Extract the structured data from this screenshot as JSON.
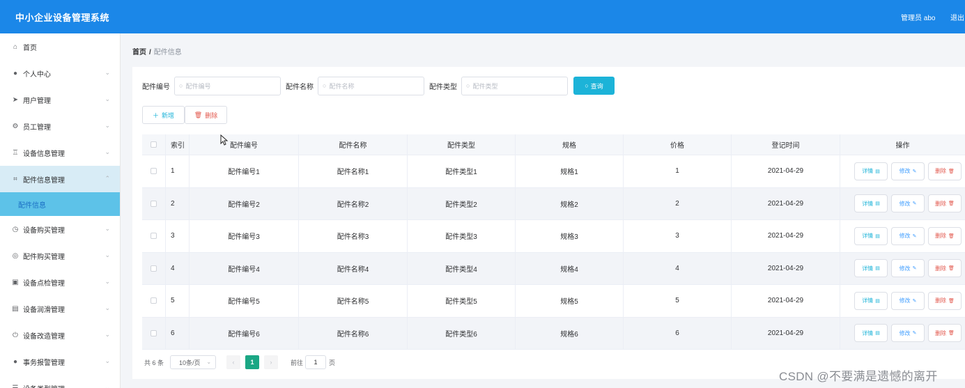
{
  "header": {
    "title": "中小企业设备管理系统",
    "admin": "管理员 abo",
    "logout": "退出"
  },
  "sidebar": {
    "items": [
      {
        "label": "首页",
        "icon": "home-icon",
        "glyph": "⌂",
        "chev": ""
      },
      {
        "label": "个人中心",
        "icon": "user-icon",
        "glyph": "●",
        "chev": "⌄"
      },
      {
        "label": "用户管理",
        "icon": "send-icon",
        "glyph": "➤",
        "chev": "⌄"
      },
      {
        "label": "员工管理",
        "icon": "gear-icon",
        "glyph": "⚙",
        "chev": "⌄"
      },
      {
        "label": "设备信息管理",
        "icon": "trophy-icon",
        "glyph": "♖",
        "chev": "⌄"
      },
      {
        "label": "配件信息管理",
        "icon": "crop-icon",
        "glyph": "⌗",
        "chev": "⌃"
      },
      {
        "label": "设备购买管理",
        "icon": "clock-icon",
        "glyph": "◷",
        "chev": "⌄"
      },
      {
        "label": "配件购买管理",
        "icon": "disc-icon",
        "glyph": "◎",
        "chev": "⌄"
      },
      {
        "label": "设备点检管理",
        "icon": "clipboard-icon",
        "glyph": "▣",
        "chev": "⌄"
      },
      {
        "label": "设备润滑管理",
        "icon": "chart-icon",
        "glyph": "▤",
        "chev": "⌄"
      },
      {
        "label": "设备改造管理",
        "icon": "power-icon",
        "glyph": "⏻",
        "chev": "⌄"
      },
      {
        "label": "事务报警管理",
        "icon": "person-icon",
        "glyph": "●",
        "chev": "⌄"
      },
      {
        "label": "设备类型管理",
        "icon": "list-icon",
        "glyph": "☰",
        "chev": "⌄"
      }
    ],
    "submenu_label": "配件信息"
  },
  "breadcrumb": {
    "home": "首页",
    "sep": "/",
    "current": "配件信息"
  },
  "search": {
    "label1": "配件编号",
    "placeholder1": "配件编号",
    "label2": "配件名称",
    "placeholder2": "配件名称",
    "label3": "配件类型",
    "placeholder3": "配件类型",
    "query": "查询"
  },
  "actions": {
    "add": "新增",
    "delete": "删除"
  },
  "table": {
    "headers": [
      "索引",
      "配件编号",
      "配件名称",
      "配件类型",
      "规格",
      "价格",
      "登记时间",
      "操作"
    ],
    "rows": [
      [
        "1",
        "配件编号1",
        "配件名称1",
        "配件类型1",
        "规格1",
        "1",
        "2021-04-29"
      ],
      [
        "2",
        "配件编号2",
        "配件名称2",
        "配件类型2",
        "规格2",
        "2",
        "2021-04-29"
      ],
      [
        "3",
        "配件编号3",
        "配件名称3",
        "配件类型3",
        "规格3",
        "3",
        "2021-04-29"
      ],
      [
        "4",
        "配件编号4",
        "配件名称4",
        "配件类型4",
        "规格4",
        "4",
        "2021-04-29"
      ],
      [
        "5",
        "配件编号5",
        "配件名称5",
        "配件类型5",
        "规格5",
        "5",
        "2021-04-29"
      ],
      [
        "6",
        "配件编号6",
        "配件名称6",
        "配件类型6",
        "规格6",
        "6",
        "2021-04-29"
      ]
    ],
    "op_detail": "详情",
    "op_edit": "修改",
    "op_remove": "删除"
  },
  "pager": {
    "total": "共 6 条",
    "size": "10条/页",
    "current": "1",
    "goto": "前往",
    "goto_value": "1",
    "page_unit": "页"
  },
  "watermark": "CSDN @不要满是遗憾的离开",
  "colors": {
    "header": "#1b87e8",
    "accent": "#1cb3d8",
    "pager_active": "#1ba784",
    "danger": "#e2574c"
  }
}
